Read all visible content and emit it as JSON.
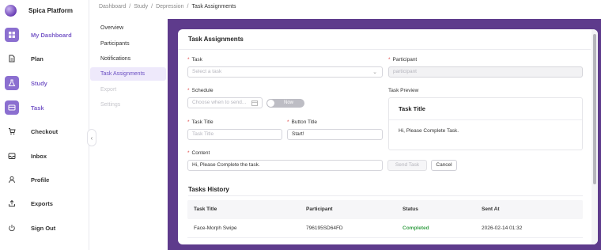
{
  "app": {
    "name": "Spica Platform",
    "accent": "#8b6fd0",
    "band_color": "#5e3b8c"
  },
  "nav": {
    "items": [
      {
        "label": "My Dashboard",
        "icon": "dashboard-grid-icon",
        "active": true
      },
      {
        "label": "Plan",
        "icon": "document-icon",
        "active": false
      },
      {
        "label": "Study",
        "icon": "flask-icon",
        "active": true
      },
      {
        "label": "Task",
        "icon": "task-card-icon",
        "active": true
      },
      {
        "label": "Checkout",
        "icon": "cart-icon",
        "active": false
      },
      {
        "label": "Inbox",
        "icon": "inbox-icon",
        "active": false
      },
      {
        "label": "Profile",
        "icon": "person-icon",
        "active": false
      },
      {
        "label": "Exports",
        "icon": "export-icon",
        "active": false
      },
      {
        "label": "Sign Out",
        "icon": "power-icon",
        "active": false
      }
    ]
  },
  "breadcrumb": [
    "Dashboard",
    "Study",
    "Depression",
    "Task Assignments"
  ],
  "subnav": {
    "items": [
      {
        "label": "Overview",
        "state": "normal"
      },
      {
        "label": "Participants",
        "state": "normal"
      },
      {
        "label": "Notifications",
        "state": "normal"
      },
      {
        "label": "Task Assignments",
        "state": "active"
      },
      {
        "label": "Export",
        "state": "disabled"
      },
      {
        "label": "Settings",
        "state": "disabled"
      }
    ]
  },
  "form": {
    "title": "Task Assignments",
    "task_label": "Task",
    "task_placeholder": "Select a task",
    "participant_label": "Participant",
    "participant_value": "participant",
    "schedule_label": "Schedule",
    "schedule_placeholder": "Choose when to send...",
    "now_label": "Now",
    "task_title_label": "Task Title",
    "task_title_placeholder": "Task Title",
    "button_title_label": "Button Title",
    "button_title_value": "Start!",
    "content_label": "Content",
    "content_value": "Hi, Please Complete the task.",
    "send_label": "Send Task",
    "cancel_label": "Cancel"
  },
  "preview": {
    "label": "Task Preview",
    "title": "Task Title",
    "body": "Hi, Please Complete Task."
  },
  "history": {
    "title": "Tasks History",
    "columns": [
      "Task Title",
      "Participant",
      "Status",
      "Sent At"
    ],
    "rows": [
      {
        "task": "Face-Morph Swipe",
        "participant": "796195SD64FD",
        "status": "Completed",
        "sent_at": "2026-02-14 01:32"
      }
    ]
  }
}
